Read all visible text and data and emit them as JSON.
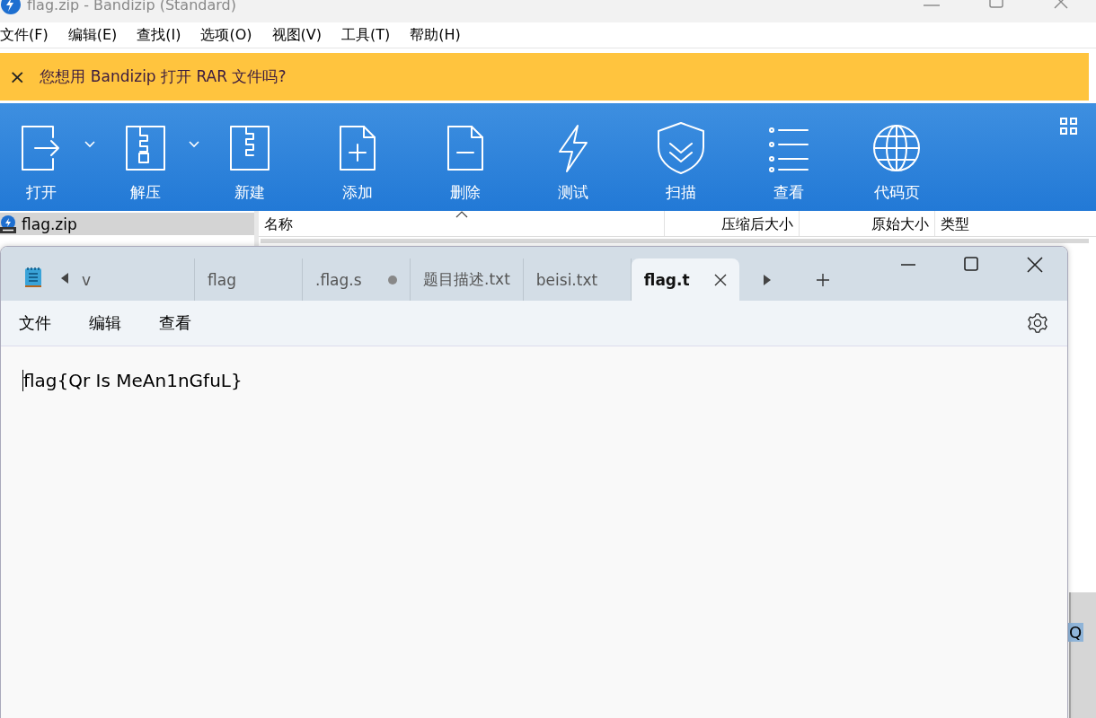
{
  "window": {
    "title": "flag.zip - Bandizip (Standard)"
  },
  "menu": [
    "文件(F)",
    "编辑(E)",
    "查找(I)",
    "选项(O)",
    "视图(V)",
    "工具(T)",
    "帮助(H)"
  ],
  "banner": {
    "text": "您想用 Bandizip 打开 RAR 文件吗?",
    "close": "×"
  },
  "toolbar": [
    {
      "label": "打开",
      "kind": "open",
      "has_menu": true
    },
    {
      "label": "解压",
      "kind": "extract",
      "has_menu": true
    },
    {
      "label": "新建",
      "kind": "new",
      "has_menu": false
    },
    {
      "label": "添加",
      "kind": "add",
      "has_menu": false
    },
    {
      "label": "删除",
      "kind": "delete",
      "has_menu": false
    },
    {
      "label": "测试",
      "kind": "test",
      "has_menu": false
    },
    {
      "label": "扫描",
      "kind": "scan",
      "has_menu": false
    },
    {
      "label": "查看",
      "kind": "view",
      "has_menu": false
    },
    {
      "label": "代码页",
      "kind": "codepage",
      "has_menu": false
    }
  ],
  "tree": [
    {
      "label": "flag.zip",
      "selected": true
    }
  ],
  "table": {
    "columns": [
      {
        "label": "名称",
        "sorted": true
      },
      {
        "label": "压缩后大小",
        "sorted": false
      },
      {
        "label": "原始大小",
        "sorted": false
      },
      {
        "label": "类型",
        "sorted": false
      }
    ]
  },
  "status_fragment": "Q",
  "notepad": {
    "tabs": [
      {
        "label": "v",
        "selected": false,
        "modified": false
      },
      {
        "label": "flag",
        "selected": false,
        "modified": false
      },
      {
        "label": ".flag.s",
        "selected": false,
        "modified": true
      },
      {
        "label": "题目描述.txt",
        "selected": false,
        "modified": false
      },
      {
        "label": "beisi.txt",
        "selected": false,
        "modified": false
      },
      {
        "label": "flag.t",
        "selected": true,
        "modified": false
      }
    ],
    "menu": [
      "文件",
      "编辑",
      "查看"
    ],
    "text": "flag{Qr Is MeAn1nGfuL}"
  }
}
